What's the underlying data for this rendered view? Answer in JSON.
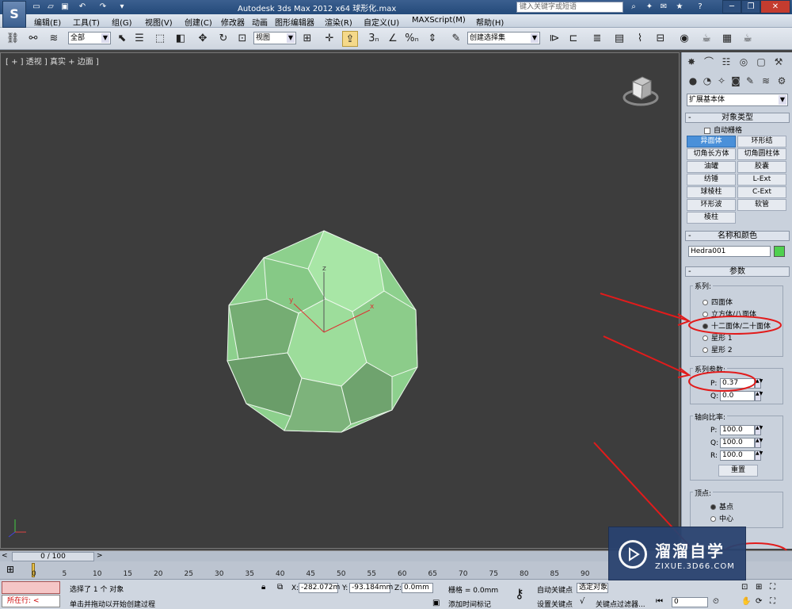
{
  "titlebar": {
    "title": "Autodesk 3ds Max  2012 x64      球形化.max",
    "search_placeholder": "键入关键字或短语"
  },
  "menu": {
    "items": [
      "编辑(E)",
      "工具(T)",
      "组(G)",
      "视图(V)",
      "创建(C)",
      "修改器",
      "动画",
      "图形编辑器",
      "渲染(R)",
      "自定义(U)",
      "MAXScript(M)",
      "帮助(H)"
    ]
  },
  "toolbar": {
    "selection_filter": "全部",
    "reference_coord": "视图",
    "named_selection": "创建选择集",
    "snap_3": "3",
    "snap_percent": "%"
  },
  "viewport": {
    "label": "[ + ] 透视 ] 真实 + 边面 ]",
    "axis_x": "x",
    "axis_y": "y",
    "axis_z": "z"
  },
  "cmdpanel": {
    "category_dropdown": "扩展基本体",
    "object_type_header": "对象类型",
    "autogrid_label": "自动栅格",
    "buttons": [
      "异面体",
      "环形结",
      "切角长方体",
      "切角圆柱体",
      "油罐",
      "胶囊",
      "纺锤",
      "L-Ext",
      "球棱柱",
      "C-Ext",
      "环形波",
      "软管",
      "棱柱"
    ],
    "name_color_header": "名称和颜色",
    "object_name": "Hedra001",
    "object_color": "#4fd04f",
    "params_header": "参数",
    "family_title": "系列:",
    "family_options": [
      "四面体",
      "立方体/八面体",
      "十二面体/二十面体",
      "星形 1",
      "星形 2"
    ],
    "family_selected": 2,
    "family_params_title": "系列参数:",
    "p_label": "P:",
    "p_value": "0.37",
    "q_label": "Q:",
    "q_value": "0.0",
    "axis_scale_title": "轴向比率:",
    "axis_p_label": "P:",
    "axis_p": "100.0",
    "axis_q_label": "Q:",
    "axis_q": "100.0",
    "axis_r_label": "R:",
    "axis_r": "100.0",
    "reset_label": "重置",
    "vertex_title": "顶点:",
    "vertex_options": [
      "基点",
      "中心"
    ],
    "vertex_selected": 0
  },
  "timeline": {
    "frame_display": "0 / 100",
    "ticks": [
      "0",
      "5",
      "10",
      "15",
      "20",
      "25",
      "30",
      "35",
      "40",
      "45",
      "50",
      "55",
      "60",
      "65",
      "70",
      "75",
      "80",
      "85",
      "90"
    ]
  },
  "status": {
    "script_label": "所在行:",
    "message_1": "选择了 1 个 对象",
    "message_2": "单击并拖动以开始创建过程",
    "x_label": "X:",
    "x_value": "-282.072m",
    "y_label": "Y:",
    "y_value": "-93.184mm",
    "z_label": "Z:",
    "z_value": "0.0mm",
    "grid": "栅格 = 0.0mm",
    "add_time_tag": "添加时间标记",
    "auto_key": "自动关键点",
    "set_key": "设置关键点",
    "selected": "选定对象",
    "key_filters": "关键点过滤器...",
    "frame": "0"
  },
  "watermark": {
    "title": "溜溜自学",
    "subtitle": "ZIXUE.3D66.COM"
  }
}
